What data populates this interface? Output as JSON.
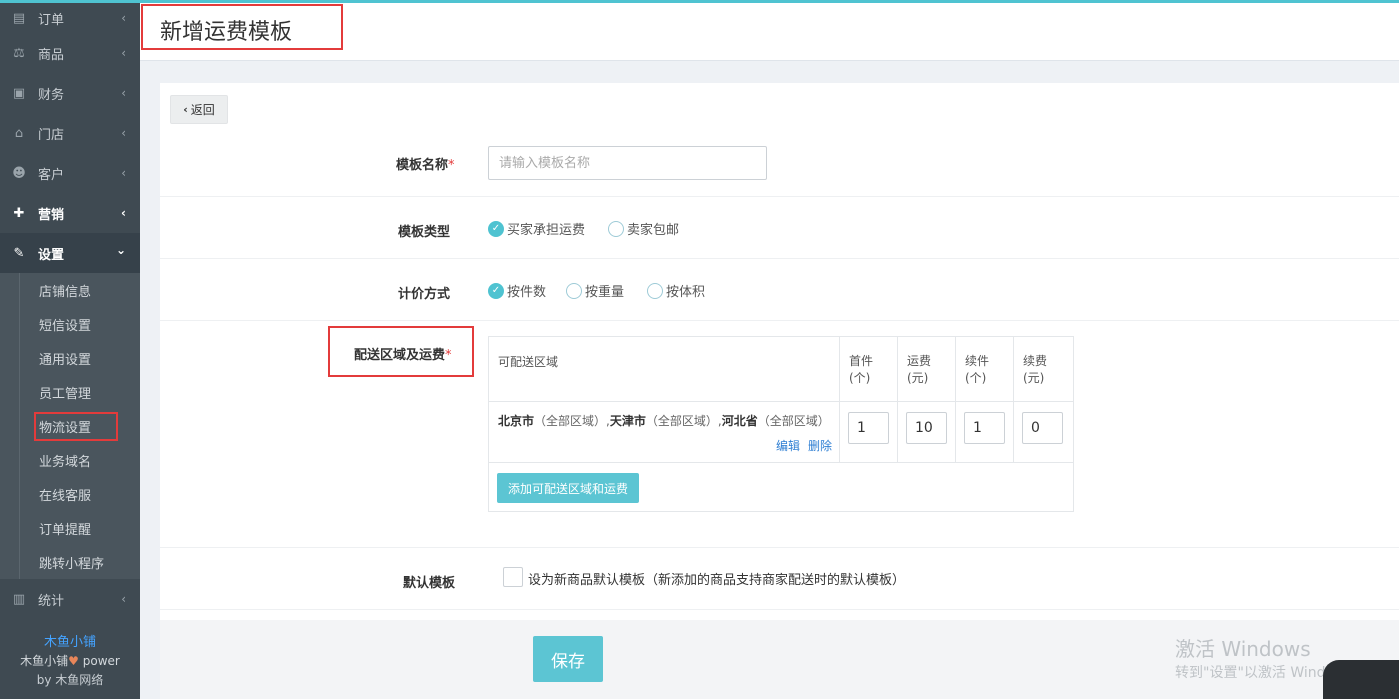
{
  "sidebar": {
    "items": [
      {
        "label": "订单",
        "icon": "order-icon"
      },
      {
        "label": "商品",
        "icon": "scale-icon"
      },
      {
        "label": "财务",
        "icon": "money-icon"
      },
      {
        "label": "门店",
        "icon": "store-icon"
      },
      {
        "label": "客户",
        "icon": "users-icon"
      },
      {
        "label": "营销",
        "icon": "gift-icon"
      },
      {
        "label": "设置",
        "icon": "wrench-icon"
      }
    ],
    "submenu": [
      "店铺信息",
      "短信设置",
      "通用设置",
      "员工管理",
      "物流设置",
      "业务域名",
      "在线客服",
      "订单提醒",
      "跳转小程序"
    ],
    "active_sub": "物流设置",
    "stats": {
      "label": "统计",
      "icon": "chart-icon"
    },
    "footer": {
      "shop": "木鱼小铺",
      "power_prefix": "木鱼小铺",
      "power_suffix": " power",
      "by_prefix": "by ",
      "by_name": "木鱼网络"
    }
  },
  "header": {
    "title": "新增运费模板"
  },
  "back": {
    "label": "返回"
  },
  "form": {
    "name": {
      "label": "模板名称",
      "required": "*",
      "placeholder": "请输入模板名称"
    },
    "type": {
      "label": "模板类型",
      "options": [
        "买家承担运费",
        "卖家包邮"
      ],
      "selected": "买家承担运费"
    },
    "pricing": {
      "label": "计价方式",
      "options": [
        "按件数",
        "按重量",
        "按体积"
      ],
      "selected": "按件数"
    },
    "area": {
      "label": "配送区域及运费",
      "required": "*",
      "headers": {
        "area": "可配送区域",
        "first_a": "首件",
        "first_b": "(个)",
        "fee_a": "运费",
        "fee_b": "(元)",
        "next_a": "续件",
        "next_b": "(个)",
        "next_fee_a": "续费",
        "next_fee_b": "(元)"
      },
      "rows": [
        {
          "c1": "北京市",
          "c1s": "（全部区域）,",
          "c2": "天津市",
          "c2s": "（全部区域）,",
          "c3": "河北省",
          "c3s": "（全部区域）",
          "first": "1",
          "fee": "10",
          "next": "1",
          "next_fee": "0",
          "edit": "编辑",
          "delete": "删除"
        }
      ],
      "add_button": "添加可配送区域和运费"
    },
    "default": {
      "label": "默认模板",
      "checkbox_label": "设为新商品默认模板（新添加的商品支持商家配送时的默认模板）"
    },
    "save": "保存"
  },
  "watermark": {
    "line1": "激活 Windows",
    "line2": "转到\"设置\"以激活 Windows。"
  }
}
